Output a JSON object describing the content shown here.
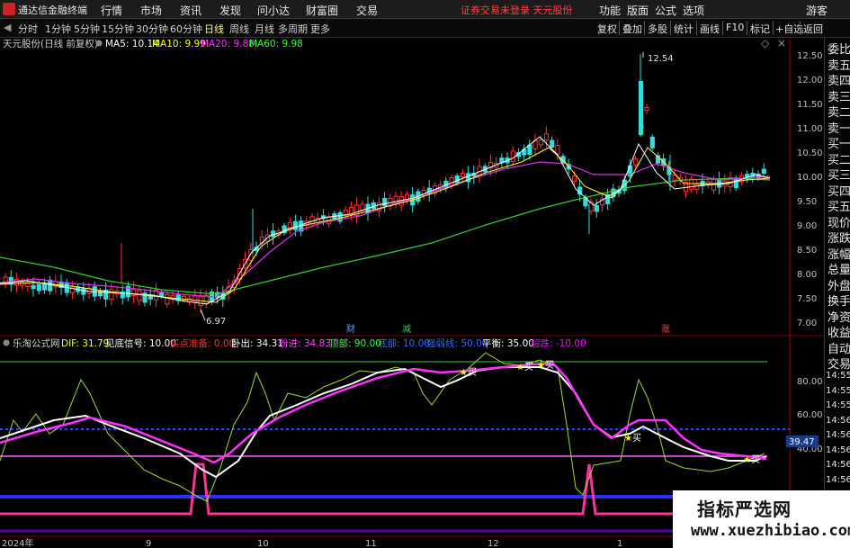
{
  "app": {
    "title": "通达信金融终端"
  },
  "menu": [
    "行情",
    "市场",
    "资讯",
    "发现",
    "问小达",
    "财富圈",
    "交易"
  ],
  "notice": "证券交易未登录  天元股份",
  "right_menu": [
    "功能",
    "版面",
    "公式",
    "选项",
    "游客"
  ],
  "periods": [
    "分时",
    "1分钟",
    "5分钟",
    "15分钟",
    "30分钟",
    "60分钟",
    "日线",
    "周线",
    "月线",
    "多周期",
    "更多"
  ],
  "active_period": "日线",
  "right_tools": [
    "复权",
    "叠加",
    "多股",
    "统计",
    "画线",
    "F10",
    "标记",
    "+自选",
    "返回"
  ],
  "stock": {
    "name": "天元股份(日线 前复权)"
  },
  "ma": [
    {
      "label": "MA5: 10.14",
      "color": "#ffffff"
    },
    {
      "label": "MA10: 9.99",
      "color": "#ffff00"
    },
    {
      "label": "MA20: 9.88",
      "color": "#ff33ff"
    },
    {
      "label": "MA60: 9.98",
      "color": "#33ff33"
    }
  ],
  "price_axis": [
    "12.50",
    "12.00",
    "11.50",
    "11.00",
    "10.50",
    "10.00",
    "9.50",
    "9.00",
    "8.50",
    "8.00",
    "7.50",
    "7.00"
  ],
  "high_label": "12.54",
  "low_label": "6.97",
  "event_marks": [
    {
      "text": "财",
      "color": "#6699ff"
    },
    {
      "text": "减",
      "color": "#33cc66"
    },
    {
      "text": "涨",
      "color": "#ff4040"
    }
  ],
  "indicator": {
    "name": "乐淘公式网",
    "values": [
      {
        "label": "DIF: 31.79",
        "color": "#ffff00"
      },
      {
        "label": "见底信号: 10.00",
        "color": "#ffffff"
      },
      {
        "label": "买点准备: 0.00",
        "color": "#ff3333"
      },
      {
        "label": "卧出: 34.31",
        "color": "#ffffff"
      },
      {
        "label": "粉进: 34.83",
        "color": "#ff44ff"
      },
      {
        "label": "顶部: 90.00",
        "color": "#33ff33"
      },
      {
        "label": "底部: 10.00",
        "color": "#3366ff"
      },
      {
        "label": "强弱线: 50.00",
        "color": "#3366ff"
      },
      {
        "label": "平衡: 35.00",
        "color": "#ffffff"
      },
      {
        "label": "超跌: -10.00",
        "color": "#ff00ff"
      }
    ],
    "axis": [
      "80.00",
      "60.00",
      "40.00"
    ],
    "current": "39.47",
    "buy_label": "买"
  },
  "time_axis": [
    "2024年",
    "9",
    "10",
    "11",
    "12",
    "1"
  ],
  "time_stamps": [
    "14:55",
    "14:55",
    "14:55",
    "14:56",
    "14:56",
    "14:56",
    "14:56",
    "14:56"
  ],
  "sidebar": [
    "委比",
    "卖五",
    "卖四",
    "卖三",
    "卖二",
    "卖一",
    "买一",
    "买二",
    "买三",
    "买四",
    "买五",
    "现价",
    "涨跌",
    "涨幅",
    "总量",
    "外盘",
    "换手",
    "净资",
    "收益",
    "自动",
    "交易"
  ],
  "watermark": {
    "title": "指标严选网",
    "url": "www.xuezhibiao.com"
  }
}
